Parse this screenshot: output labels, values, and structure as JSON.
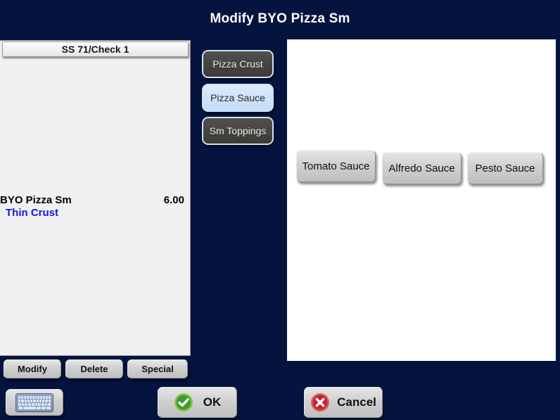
{
  "window": {
    "title": "Modify BYO Pizza Sm",
    "background_color": "#05143f"
  },
  "order_panel": {
    "header": "SS 71/Check 1",
    "items": [
      {
        "name": "BYO Pizza Sm",
        "price": "6.00",
        "modifiers": [
          "Thin Crust"
        ]
      }
    ],
    "actions": [
      {
        "label": "Modify"
      },
      {
        "label": "Delete"
      },
      {
        "label": "Special"
      }
    ]
  },
  "categories": [
    {
      "label": "Pizza Crust",
      "selected": false
    },
    {
      "label": "Pizza Sauce",
      "selected": true
    },
    {
      "label": "Sm Toppings",
      "selected": false
    }
  ],
  "options": [
    {
      "label": "Tomato Sauce"
    },
    {
      "label": "Alfredo Sauce"
    },
    {
      "label": "Pesto Sauce"
    }
  ],
  "footer": {
    "keyboard_icon": "keyboard-icon",
    "ok_label": "OK",
    "ok_icon": "green-check-circle-icon",
    "cancel_label": "Cancel",
    "cancel_icon": "red-x-circle-icon"
  },
  "colors": {
    "background": "#05143f",
    "selected_category": "#cfe3f8",
    "inactive_category": "#474541",
    "modifier_text": "#1414e6",
    "ok_green": "#3f9c35",
    "cancel_red": "#c0272d"
  }
}
